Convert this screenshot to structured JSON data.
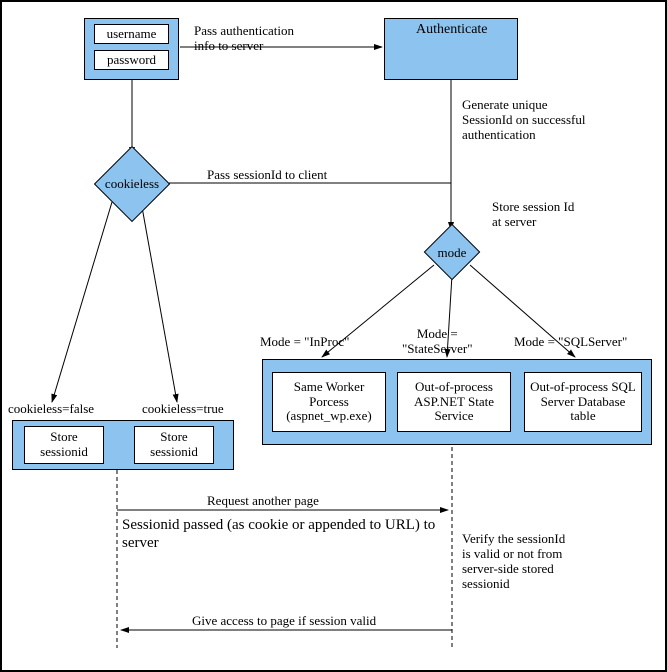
{
  "login": {
    "username": "username",
    "password": "password"
  },
  "authenticate_title": "Authenticate",
  "edge_pass_auth": "Pass authentication\ninfo to server",
  "edge_gen_session": "Generate unique\nSessionId on successful\nauthentication",
  "cookieless_label": "cookieless",
  "edge_pass_sessionid": "Pass sessionId to client",
  "edge_store_session": "Store session Id\nat server",
  "mode_label": "mode",
  "mode_inproc": "Mode = \"InProc\"",
  "mode_stateserver": "Mode =\n\"StateServer\"",
  "mode_sqlserver": "Mode = \"SQLServer\"",
  "mode_box1": "Same Worker\nPorcess\n(aspnet_wp.exe)",
  "mode_box2": "Out-of-process\nASP.NET State\nService",
  "mode_box3": "Out-of-process\nSQL Server\nDatabase table",
  "cookieless_false": "cookieless=false",
  "cookieless_true": "cookieless=true",
  "store_sessionid": "Store\nsessionid",
  "req_another_page": "Request another page",
  "session_passed": "Sessionid passed (as cookie or appended to URL) to\nserver",
  "verify_session": "Verify the sessionId\nis valid or not from\nserver-side stored\nsessionid",
  "give_access": "Give access to page if session valid"
}
